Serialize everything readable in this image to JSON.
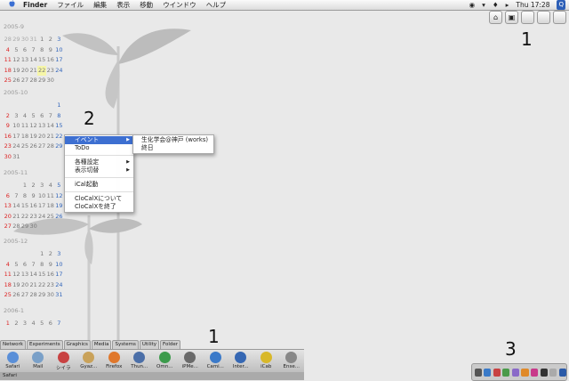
{
  "menubar": {
    "apple": "",
    "menus": [
      "Finder",
      "ファイル",
      "編集",
      "表示",
      "移動",
      "ウインドウ",
      "ヘルプ"
    ],
    "clock": "Thu 17:28",
    "spotlight": "Q"
  },
  "calendar": {
    "months": [
      {
        "title": "2005-9",
        "weeks": [
          [
            "28",
            "29",
            "30",
            "31",
            "1",
            "2",
            "3"
          ],
          [
            "4",
            "5",
            "6",
            "7",
            "8",
            "9",
            "10"
          ],
          [
            "11",
            "12",
            "13",
            "14",
            "15",
            "16",
            "17"
          ],
          [
            "18",
            "19",
            "20",
            "21",
            "22",
            "23",
            "24"
          ],
          [
            "25",
            "26",
            "27",
            "28",
            "29",
            "30",
            ""
          ]
        ]
      },
      {
        "title": "2005-10",
        "weeks": [
          [
            "",
            "",
            "",
            "",
            "",
            "",
            "1"
          ],
          [
            "2",
            "3",
            "4",
            "5",
            "6",
            "7",
            "8"
          ],
          [
            "9",
            "10",
            "11",
            "12",
            "13",
            "14",
            "15"
          ],
          [
            "16",
            "17",
            "18",
            "19",
            "20",
            "21",
            "22"
          ],
          [
            "23",
            "24",
            "25",
            "26",
            "27",
            "28",
            "29"
          ],
          [
            "30",
            "31",
            "",
            "",
            "",
            "",
            ""
          ]
        ]
      },
      {
        "title": "2005-11",
        "weeks": [
          [
            "",
            "",
            "1",
            "2",
            "3",
            "4",
            "5"
          ],
          [
            "6",
            "7",
            "8",
            "9",
            "10",
            "11",
            "12"
          ],
          [
            "13",
            "14",
            "15",
            "16",
            "17",
            "18",
            "19"
          ],
          [
            "20",
            "21",
            "22",
            "23",
            "24",
            "25",
            "26"
          ],
          [
            "27",
            "28",
            "29",
            "30",
            "",
            "",
            ""
          ]
        ]
      },
      {
        "title": "2005-12",
        "weeks": [
          [
            "",
            "",
            "",
            "",
            "1",
            "2",
            "3"
          ],
          [
            "4",
            "5",
            "6",
            "7",
            "8",
            "9",
            "10"
          ],
          [
            "11",
            "12",
            "13",
            "14",
            "15",
            "16",
            "17"
          ],
          [
            "18",
            "19",
            "20",
            "21",
            "22",
            "23",
            "24"
          ],
          [
            "25",
            "26",
            "27",
            "28",
            "29",
            "30",
            "31"
          ]
        ]
      },
      {
        "title": "2006-1",
        "weeks": [
          [
            "1",
            "2",
            "3",
            "4",
            "5",
            "6",
            "7"
          ]
        ]
      }
    ]
  },
  "context_menu": {
    "items": [
      {
        "label": "イベント",
        "submenu": true
      },
      {
        "label": "ToDo"
      },
      {
        "label": "各種設定",
        "submenu": true
      },
      {
        "label": "表示切替",
        "submenu": true
      },
      {
        "label": "iCal起動"
      },
      {
        "label": "CloCalXについて"
      },
      {
        "label": "CloCalXを終了"
      }
    ]
  },
  "submenu": {
    "items": [
      "生化学会@神戸 (works)",
      "終日"
    ]
  },
  "annotations": {
    "a1_top": "1",
    "a2": "2",
    "a1_bottom": "1",
    "a3": "3"
  },
  "drawer": {
    "tabs": [
      "Network",
      "Experiments",
      "Graphics",
      "Media",
      "Systems",
      "Utility",
      "Folder"
    ],
    "apps": [
      "Safari",
      "Mail",
      "シイラ",
      "Gyaz...",
      "Firefox",
      "Thun...",
      "Omn...",
      "iPMe...",
      "Cami...",
      "Inter...",
      "iCab",
      "Ense..."
    ],
    "status": "Safari"
  },
  "colors": {
    "highlight": "#3d6fd1",
    "sunday": "#dd2222",
    "saturday": "#3366bb"
  }
}
